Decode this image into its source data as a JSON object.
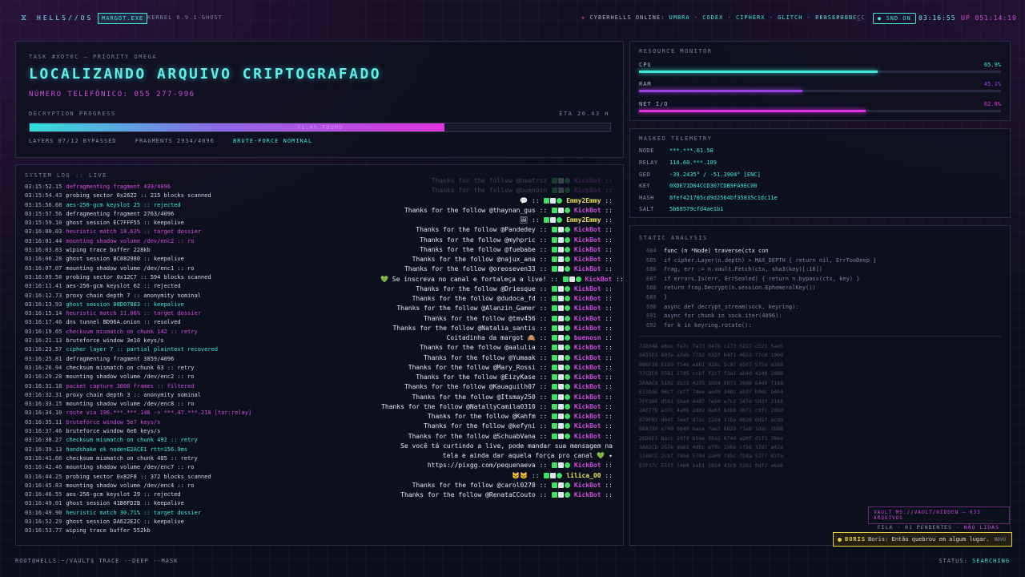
{
  "topbar": {
    "brand": "HELLS//OS",
    "session_badge": "MARGOT.EXE",
    "kernel": "KERNEL 6.9.1-GHOST",
    "online_label": "CYBERHELLS ONLINE:",
    "online_users": [
      "UMBRA",
      "CODEX",
      "CIPHERX",
      "GLITCH",
      "PERSEPHONE_"
    ],
    "sid": "SID 53C7CECC",
    "snd_button": "SND ON",
    "clock": "03:16:55",
    "uptime": "UP 051:14:19"
  },
  "task": {
    "id": "TASK #XD70C — PRIORITY OMEGA",
    "title": "LOCALIZANDO ARQUIVO CRIPTOGRAFADO",
    "phone": "NÚMERO TELEFÔNICO: 055 277-996",
    "progress_label": "DECRYPTION PROGRESS",
    "eta": "ETA 20.43 H",
    "progress_percent": 71.4,
    "progress_text": "71.4% FOUND",
    "layers": "LAYERS 07/12 BYPASSED",
    "fragments": "FRAGMENTS 2934/4096",
    "bruteforce": "BRUTE-FORCE NOMINAL"
  },
  "syslog": {
    "header": "SYSTEM LOG :: LIVE",
    "rows": [
      {
        "t": "03:15:52.15",
        "m": "defragmenting fragment 439/4096",
        "c": "mag"
      },
      {
        "t": "03:15:54.43",
        "m": "probing sector 0x2622 :: 215 blocks scanned",
        "c": ""
      },
      {
        "t": "03:15:56.68",
        "m": "aes-256-gcm keyslot 25 :: rejected",
        "c": "cyn"
      },
      {
        "t": "03:15:57.56",
        "m": "defragmenting fragment 2763/4096",
        "c": ""
      },
      {
        "t": "03:15:59.10",
        "m": "ghost session EC7FFF55 :: keepalive",
        "c": ""
      },
      {
        "t": "03:16:00.03",
        "m": "heuristic match 18.63% :: target dossier",
        "c": "mag"
      },
      {
        "t": "03:16:01.44",
        "m": "mounting shadow volume /dev/enc2 :: ro",
        "c": "mag"
      },
      {
        "t": "03:16:03.83",
        "m": "wiping trace buffer 228kb",
        "c": ""
      },
      {
        "t": "03:16:06.28",
        "m": "ghost session BC882980 :: keepalive",
        "c": ""
      },
      {
        "t": "03:16:07.07",
        "m": "mounting shadow volume /dev/enc1 :: ro",
        "c": ""
      },
      {
        "t": "03:16:09.58",
        "m": "probing sector 0x12C7 :: 594 blocks scanned",
        "c": ""
      },
      {
        "t": "03:16:11.41",
        "m": "aes-256-gcm keyslot 62 :: rejected",
        "c": ""
      },
      {
        "t": "03:16:12.73",
        "m": "proxy chain depth 7 :: anonymity nominal",
        "c": ""
      },
      {
        "t": "03:16:13.93",
        "m": "ghost session 08D07883 :: keepalive",
        "c": "cyn"
      },
      {
        "t": "03:16:15.14",
        "m": "heuristic match 11.06% :: target dossier",
        "c": "mag"
      },
      {
        "t": "03:16:17.46",
        "m": "dns tunnel BD06A.onion :: resolved",
        "c": ""
      },
      {
        "t": "03:16:19.65",
        "m": "checksum mismatch on chunk 142 :: retry",
        "c": "mag"
      },
      {
        "t": "03:16:21.13",
        "m": "bruteforce window 3e10 keys/s",
        "c": ""
      },
      {
        "t": "03:16:23.57",
        "m": "cipher layer 7 :: partial plaintext recovered",
        "c": "cyn"
      },
      {
        "t": "03:16:25.81",
        "m": "defragmenting fragment 3859/4096",
        "c": ""
      },
      {
        "t": "03:16:26.94",
        "m": "checksum mismatch on chunk 63 :: retry",
        "c": ""
      },
      {
        "t": "03:16:29.28",
        "m": "mounting shadow volume /dev/enc2 :: ro",
        "c": ""
      },
      {
        "t": "03:16:31.18",
        "m": "packet capture 3008 frames :: filtered",
        "c": "mag"
      },
      {
        "t": "03:16:32.31",
        "m": "proxy chain depth 3 :: anonymity nominal",
        "c": ""
      },
      {
        "t": "03:16:33.15",
        "m": "mounting shadow volume /dev/enc8 :: ro",
        "c": ""
      },
      {
        "t": "03:16:34.10",
        "m": "route via 196.***.***.146 -> ***.47.***.218 [tor:relay]",
        "c": "mag"
      },
      {
        "t": "03:16:35.11",
        "m": "bruteforce window 5e7 keys/s",
        "c": "mag"
      },
      {
        "t": "03:16:37.46",
        "m": "bruteforce window 6e6 keys/s",
        "c": ""
      },
      {
        "t": "03:16:38.27",
        "m": "checksum mismatch on chunk 492 :: retry",
        "c": "cyn"
      },
      {
        "t": "03:16:39.13",
        "m": "handshake ok node=E2ACE1 rtt=156.9ms",
        "c": "cyn"
      },
      {
        "t": "03:16:41.66",
        "m": "checksum mismatch on chunk 405 :: retry",
        "c": ""
      },
      {
        "t": "03:16:42.46",
        "m": "mounting shadow volume /dev/enc7 :: ro",
        "c": ""
      },
      {
        "t": "03:16:44.25",
        "m": "probing sector 0x82F8 :: 372 blocks scanned",
        "c": ""
      },
      {
        "t": "03:16:45.83",
        "m": "mounting shadow volume /dev/enc4 :: ro",
        "c": ""
      },
      {
        "t": "03:16:46.55",
        "m": "aes-256-gcm keyslot 29 :: rejected",
        "c": ""
      },
      {
        "t": "03:16:49.01",
        "m": "ghost session 41B8FD2B :: keepalive",
        "c": ""
      },
      {
        "t": "03:16:49.90",
        "m": "heuristic match 30.71% :: target dossier",
        "c": "cyn"
      },
      {
        "t": "03:16:52.29",
        "m": "ghost session DA622E2C :: keepalive",
        "c": ""
      },
      {
        "t": "03:16:53.77",
        "m": "wiping trace buffer 552kb",
        "c": ""
      }
    ]
  },
  "chat": {
    "messages": [
      {
        "text": "Thanks for the follow @beatrsz",
        "who": "KickBot",
        "faded": true
      },
      {
        "text": "Thanks for the follow @buenosn",
        "who": "KickBot",
        "faded": true
      },
      {
        "text": "💬 ::",
        "who": "Emmy2Emmy",
        "y": true
      },
      {
        "text": "Thanks for the follow @thaynan_gus ::",
        "who": "KickBot"
      },
      {
        "text": "🖼 ::",
        "who": "Emmy2Emmy",
        "y": true
      },
      {
        "text": "Thanks for the follow @Pandedey ::",
        "who": "KickBot"
      },
      {
        "text": "Thanks for the follow @myhpric ::",
        "who": "KickBot"
      },
      {
        "text": "Thanks for the follow @fuebabe ::",
        "who": "KickBot"
      },
      {
        "text": "Thanks for the follow @najux_ana ::",
        "who": "KickBot"
      },
      {
        "text": "Thanks for the follow @oreoseven33 ::",
        "who": "KickBot"
      },
      {
        "text": "💚 Se inscreva no canal e fortaleça a live! ::",
        "who": "KickBot"
      },
      {
        "text": "Thanks for the follow @Driesque ::",
        "who": "KickBot"
      },
      {
        "text": "Thanks for the follow @dudoca_fd ::",
        "who": "KickBot"
      },
      {
        "text": "Thanks for the follow @Alanzin_Gamer ::",
        "who": "KickBot"
      },
      {
        "text": "Thanks for the follow @tmv456 ::",
        "who": "KickBot"
      },
      {
        "text": "Thanks for the follow @Natalia_santis ::",
        "who": "KickBot"
      },
      {
        "text": "Coitadinha da margot 🙈 ::",
        "who": "buenosn",
        "y": false
      },
      {
        "text": "Thanks for the follow @aalulia ::",
        "who": "KickBot"
      },
      {
        "text": "Thanks for the follow @Yumaak ::",
        "who": "KickBot"
      },
      {
        "text": "Thanks for the follow @Mary_Rossi ::",
        "who": "KickBot"
      },
      {
        "text": "Thanks for the follow @EizyKase ::",
        "who": "KickBot"
      },
      {
        "text": "Thanks for the follow @Kauaguilh07 ::",
        "who": "KickBot"
      },
      {
        "text": "Thanks for the follow @Itsmay250 ::",
        "who": "KickBot"
      },
      {
        "text": "Thanks for the follow @NatallyCamila0310 ::",
        "who": "KickBot"
      },
      {
        "text": "Thanks for the follow @Kahfm ::",
        "who": "KickBot"
      },
      {
        "text": "Thanks for the follow @kefyni ::",
        "who": "KickBot"
      },
      {
        "text": "Thanks for the follow @SchuabVana ::",
        "who": "KickBot"
      },
      {
        "text": "Se você tá curtindo a live, pode mandar sua mensagem na",
        "who": ""
      },
      {
        "text": "tela e ainda dar aquela força pro canal 💚 ✦",
        "who": ""
      },
      {
        "text": "https://pixgg.com/pequenaeva ::",
        "who": "KickBot"
      },
      {
        "text": "🐱🐱 ::",
        "who": "lilica_00",
        "y": true
      },
      {
        "text": "Thanks for the follow @carol0278 ::",
        "who": "KickBot"
      },
      {
        "text": "Thanks for the follow @RenataCCouto ::",
        "who": "KickBot"
      }
    ]
  },
  "resource_monitor": {
    "header": "RESOURCE MONITOR",
    "meters": [
      {
        "label": "CPU",
        "value": "65.9%",
        "fraction": 0.659,
        "color": "#3ee6d6"
      },
      {
        "label": "RAM",
        "value": "45.1%",
        "fraction": 0.451,
        "color": "#a040e0"
      },
      {
        "label": "NET I/O",
        "value": "62.6%",
        "fraction": 0.626,
        "color": "#e034e0"
      }
    ]
  },
  "telemetry": {
    "header": "MASKED TELEMETRY",
    "rows": [
      {
        "k": "NODE",
        "v": "***.***.61.58"
      },
      {
        "k": "RELAY",
        "v": "114.60.***.189"
      },
      {
        "k": "GEO",
        "v": "-39.2435° / -51.3904° [ENC]"
      },
      {
        "k": "KEY",
        "v": "0XDE71D04CCD307CDB9FA9EC00"
      },
      {
        "k": "HASH",
        "v": "8fef421785cd9d2564bf35835c1dc11e"
      },
      {
        "k": "SALT",
        "v": "5b68579cfd4ae1b1"
      }
    ]
  },
  "static_analysis": {
    "header": "STATIC ANALYSIS",
    "code": [
      {
        "no": "684",
        "line": "func (n *Node) traverse(ctx con",
        "hi": true
      },
      {
        "no": "685",
        "line": "if cipher.Layer(n.depth) > MAX_DEPTH { return nil, ErrTooDeep }",
        "hi": false
      },
      {
        "no": "686",
        "line": "frag, err := n.vault.Fetch(ctx, sha3(key)[:16])",
        "hi": false
      },
      {
        "no": "687",
        "line": "if errors.Is(err, ErrSealed) { return n.bypass(ctx, key) }",
        "hi": false
      },
      {
        "no": "688",
        "line": "return frag.Decrypt(n.session.EphemeralKey())",
        "hi": false
      },
      {
        "no": "689",
        "line": "}",
        "hi": false
      },
      {
        "no": "690",
        "line": "async def decrypt_stream(sock, keyring):",
        "hi": false
      },
      {
        "no": "691",
        "line": "async for chunk in sock.iter(4096):",
        "hi": false
      },
      {
        "no": "692",
        "line": "for k in keyring.rotate():",
        "hi": false
      }
    ],
    "hex": [
      "71D34A  e8ac fe7c fa73 347b c173 5217 c521 5ae5",
      "0A55E3  89fe a3eb 7752 832f b4f1 4652 77c0 190d",
      "8B6F38  61b9 f54e e861 928c 5c97 e507 575a a388",
      "37CDC0  5581 27d5 ccbf f2c7 f3a1 ab4d 4240 2d88",
      "26AAC8  5102 2b21 4235 3dd4 8973 39d8 6440 f188",
      "E218AE  96cf ceff 74ee aed9 348c a597 b0dc b464",
      "7FF26E  d501 5bad 4487 fe58 e7c2 347e 583f 3186",
      "2AE77D  a37c 4a0b 2d02 9a63 83b8 dbf1 c9fc 2d5d",
      "979F85  d04f 7eef d72c 22d4 37be 0b20 085f acdd",
      "6BA789  e740 9849 6ace 7ae3 8d29 f1eb 1dac 1b88",
      "2ED6E1  bacc 2dfd b5ae 36a1 6744 a20f d1f3 38ee",
      "3A82CD  257e da62 4dbc ef0c 196e cf56 37d7 a42e",
      "1168CC  2cbf 76bd 570d 2a09 795c fb8a 5277 43fe",
      "E7F37C  551f 7408 1a51 5834 43c9 5261 0df2 e6a6"
    ],
    "vault": "VAULT MS://VAULT/HIDDEN — 033 ARQUIVOS",
    "fila": "FILA · 01 PENDENTES ·",
    "nao_lidas": "NÃO LIDAS"
  },
  "notification": {
    "name": "BORIS",
    "message": "Boris: Então quebrou em algum lugar.",
    "tag": "NOVO"
  },
  "bottom": {
    "prompt": "ROOT@HELLS:~/VAULT$ TRACE --DEEP --MASK",
    "status_label": "STATUS:",
    "status_value": "SEARCHING"
  }
}
